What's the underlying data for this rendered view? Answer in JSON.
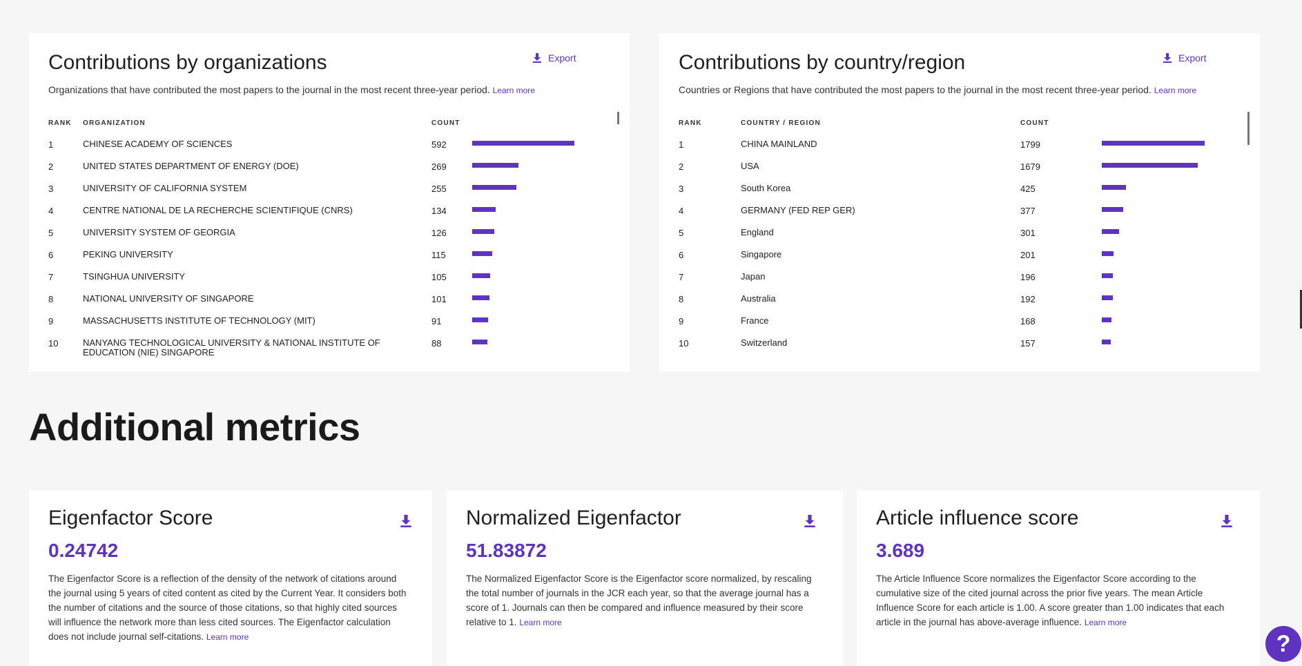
{
  "org_card": {
    "title": "Contributions by organizations",
    "export_label": "Export",
    "description": "Organizations that have contributed the most papers to the journal in the most recent three-year period.",
    "learn_more": "Learn more",
    "headers": {
      "rank": "RANK",
      "name": "ORGANIZATION",
      "count": "COUNT"
    },
    "rows": [
      {
        "rank": "1",
        "name": "CHINESE ACADEMY OF SCIENCES",
        "count": "592",
        "value": 592
      },
      {
        "rank": "2",
        "name": "UNITED STATES DEPARTMENT OF ENERGY (DOE)",
        "count": "269",
        "value": 269
      },
      {
        "rank": "3",
        "name": "UNIVERSITY OF CALIFORNIA SYSTEM",
        "count": "255",
        "value": 255
      },
      {
        "rank": "4",
        "name": "CENTRE NATIONAL DE LA RECHERCHE SCIENTIFIQUE (CNRS)",
        "count": "134",
        "value": 134
      },
      {
        "rank": "5",
        "name": "UNIVERSITY SYSTEM OF GEORGIA",
        "count": "126",
        "value": 126
      },
      {
        "rank": "6",
        "name": "PEKING UNIVERSITY",
        "count": "115",
        "value": 115
      },
      {
        "rank": "7",
        "name": "TSINGHUA UNIVERSITY",
        "count": "105",
        "value": 105
      },
      {
        "rank": "8",
        "name": "NATIONAL UNIVERSITY OF SINGAPORE",
        "count": "101",
        "value": 101
      },
      {
        "rank": "9",
        "name": "MASSACHUSETTS INSTITUTE OF TECHNOLOGY (MIT)",
        "count": "91",
        "value": 91
      },
      {
        "rank": "10",
        "name": "NANYANG TECHNOLOGICAL UNIVERSITY & NATIONAL INSTITUTE OF EDUCATION (NIE) SINGAPORE",
        "count": "88",
        "value": 88
      }
    ]
  },
  "country_card": {
    "title": "Contributions by country/region",
    "export_label": "Export",
    "description": "Countries or Regions that have contributed the most papers to the journal in the most recent three-year period.",
    "learn_more": "Learn more",
    "headers": {
      "rank": "RANK",
      "name": "COUNTRY / REGION",
      "count": "COUNT"
    },
    "rows": [
      {
        "rank": "1",
        "name": "CHINA MAINLAND",
        "count": "1799",
        "value": 1799
      },
      {
        "rank": "2",
        "name": "USA",
        "count": "1679",
        "value": 1679
      },
      {
        "rank": "3",
        "name": "South Korea",
        "count": "425",
        "value": 425
      },
      {
        "rank": "4",
        "name": "GERMANY (FED REP GER)",
        "count": "377",
        "value": 377
      },
      {
        "rank": "5",
        "name": "England",
        "count": "301",
        "value": 301
      },
      {
        "rank": "6",
        "name": "Singapore",
        "count": "201",
        "value": 201
      },
      {
        "rank": "7",
        "name": "Japan",
        "count": "196",
        "value": 196
      },
      {
        "rank": "8",
        "name": "Australia",
        "count": "192",
        "value": 192
      },
      {
        "rank": "9",
        "name": "France",
        "count": "168",
        "value": 168
      },
      {
        "rank": "10",
        "name": "Switzerland",
        "count": "157",
        "value": 157
      }
    ]
  },
  "additional": {
    "title": "Additional metrics",
    "metrics": [
      {
        "title": "Eigenfactor Score",
        "value": "0.24742",
        "description": "The Eigenfactor Score is a reflection of the density of the network of citations around the journal using 5 years of cited content as cited by the Current Year. It considers both the number of citations and the source of those citations, so that highly cited sources will influence the network more than less cited sources. The Eigenfactor calculation does not include journal self-citations.",
        "learn_more": "Learn more"
      },
      {
        "title": "Normalized Eigenfactor",
        "value": "51.83872",
        "description": "The Normalized Eigenfactor Score is the Eigenfactor score normalized, by rescaling the total number of journals in the JCR each year, so that the average journal has a score of 1. Journals can then be compared and influence measured by their score relative to 1.",
        "learn_more": "Learn more"
      },
      {
        "title": "Article influence score",
        "value": "3.689",
        "description": "The Article Influence Score normalizes the Eigenfactor Score according to the cumulative size of the cited journal across the prior five years. The mean Article Influence Score for each article is 1.00. A score greater than 1.00 indicates that each article in the journal has above-average influence.",
        "learn_more": "Learn more"
      }
    ]
  },
  "help_label": "?",
  "colors": {
    "accent": "#5e33bf",
    "background": "#f6f6f6",
    "card": "#ffffff"
  }
}
